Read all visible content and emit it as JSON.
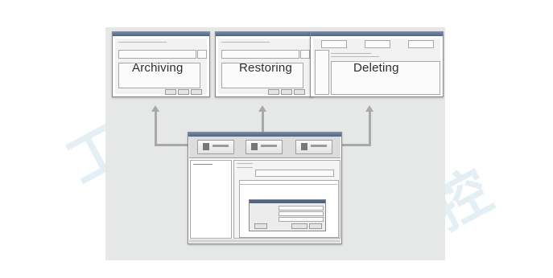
{
  "captions": {
    "archiving": "Archiving",
    "restoring": "Restoring",
    "deleting": "Deleting"
  },
  "watermark": {
    "glyph": "工控"
  },
  "colors": {
    "panel_background": "#e6e7e7",
    "connector": "#a9a9a9",
    "window_titlebar": "#4e6587",
    "watermark": "#cfe3ee"
  }
}
